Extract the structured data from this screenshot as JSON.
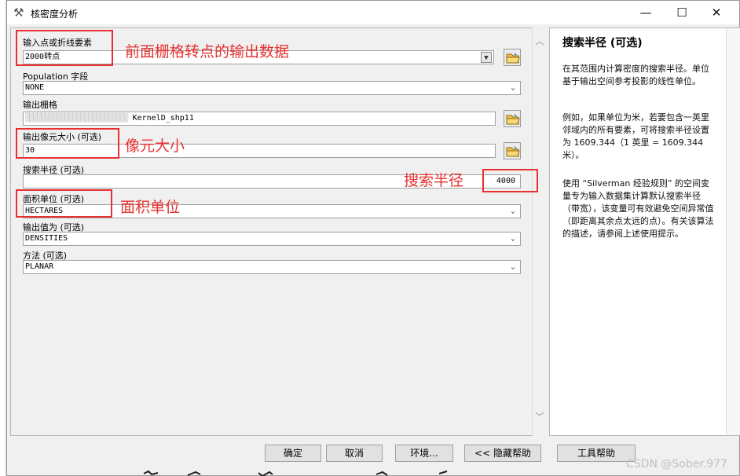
{
  "window": {
    "title": "核密度分析"
  },
  "titlebar_controls": {
    "minimize": "—",
    "maximize": "☐",
    "close": "✕"
  },
  "fields": {
    "input": {
      "label": "输入点或折线要素",
      "value": "2000转点"
    },
    "population": {
      "label": "Population 字段",
      "value": "NONE"
    },
    "output_raster": {
      "label": "输出栅格",
      "value_blur": "▒▒▒▒▒▒▒▒▒▒▒▒▒▒▒▒▒▒▒▒▒▒▒▒▒▒",
      "value_tail": "KernelD_shp11"
    },
    "cell_size": {
      "label": "输出像元大小 (可选)",
      "value": "30"
    },
    "search_radius": {
      "label": "搜索半径 (可选)",
      "value": "4000"
    },
    "area_units": {
      "label": "面积单位 (可选)",
      "value": "HECTARES"
    },
    "output_values": {
      "label": "输出值为 (可选)",
      "value": "DENSITIES"
    },
    "method": {
      "label": "方法 (可选)",
      "value": "PLANAR"
    }
  },
  "annotations": {
    "input": "前面栅格转点的输出数据",
    "cell_size": "像元大小",
    "search_radius": "搜索半径",
    "area_units": "面积单位"
  },
  "help": {
    "title": "搜索半径 (可选)",
    "para1": "在其范围内计算密度的搜索半径。单位基于输出空间参考投影的线性单位。",
    "para2": "例如，如果单位为米，若要包含一英里邻域内的所有要素，可将搜索半径设置为 1609.344（1 英里 = 1609.344 米）。",
    "para3": "使用 “Silverman 经验规则” 的空间变量专为输入数据集计算默认搜索半径（带宽），该变量可有效避免空间异常值（即距离其余点太远的点）。有关该算法的描述，请参阅上述使用提示。"
  },
  "buttons": {
    "ok": "确定",
    "cancel": "取消",
    "env": "环境...",
    "hide_help": "<< 隐藏帮助",
    "tool_help": "工具帮助"
  },
  "watermark": "CSDN @Sober.977",
  "colors": {
    "annotation": "#e83030",
    "panel_bg": "#f0f0f0"
  },
  "icons": {
    "title": "hammer-icon",
    "folder": "open-folder-icon",
    "dropdown": "chevron-down-icon"
  }
}
